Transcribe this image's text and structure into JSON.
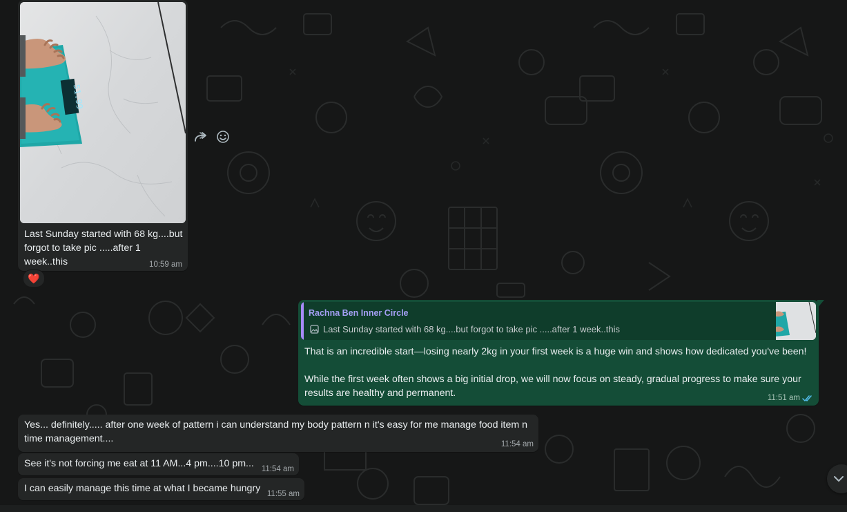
{
  "image_message": {
    "scale_reading": "51.99",
    "caption": "Last Sunday started with 68 kg....but forgot to take pic .....after 1 week..this",
    "time": "10:59 am",
    "reaction": "❤️"
  },
  "hover_actions": {
    "forward_icon": "forward-icon",
    "emoji_icon": "emoji-icon"
  },
  "reply_message": {
    "quoted_author": "Rachna Ben Inner Circle",
    "quoted_text": "Last Sunday started with 68 kg....but forgot to take pic .....after 1 week..this",
    "paragraph1": "That is an incredible start—losing nearly 2kg in your first week is a huge win and shows how dedicated you've been!",
    "paragraph2": "While the first week often shows a big initial drop, we will now focus on steady, gradual progress to make sure your results are healthy and permanent.",
    "time": "11:51 am",
    "status": "read"
  },
  "messages": [
    {
      "text": "Yes... definitely..... after one week of pattern i can understand my body pattern n it's easy for me manage food item n time management....",
      "time": "11:54 am"
    },
    {
      "text": "See it's not forcing me eat at 11 AM...4 pm....10 pm...",
      "time": "11:54 am"
    },
    {
      "text": "I can easily manage this time at what I became hungry",
      "time": "11:55 am"
    }
  ],
  "colors": {
    "incoming_bubble": "#242626",
    "outgoing_bubble": "#144d37",
    "quote_accent": "#a78bfa",
    "read_ticks": "#53bdeb"
  }
}
